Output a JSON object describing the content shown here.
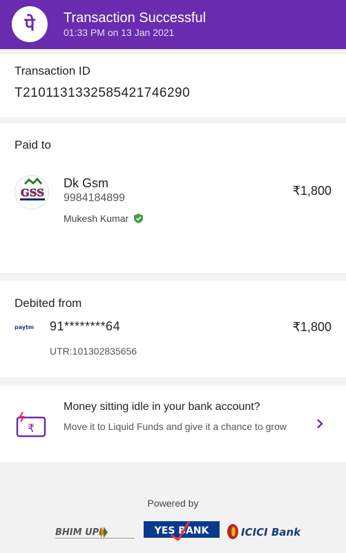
{
  "header": {
    "title": "Transaction Successful",
    "timestamp": "01:33 PM on 13 Jan 2021",
    "logo_icon": "phonepe-logo-icon",
    "bg_color": "#6a2cae"
  },
  "transaction": {
    "label": "Transaction ID",
    "id": "T2101131332585421746290"
  },
  "paid_to": {
    "label": "Paid to",
    "name": "Dk Gsm",
    "phone": "9984184899",
    "verified_name": "Mukesh Kumar",
    "amount": "₹1,800",
    "avatar_text": "GSS"
  },
  "debited_from": {
    "label": "Debited from",
    "account": "91********64",
    "utr": "UTR:101302835656",
    "amount": "₹1,800",
    "wallet_logo_text": "paytm"
  },
  "promo": {
    "title": "Money sitting idle in your bank account?",
    "subtitle": "Move it to Liquid Funds and give it a chance to grow"
  },
  "footer": {
    "powered_by": "Powered by",
    "partners": [
      "BHIM UPI",
      "YES BANK",
      "ICICI Bank"
    ]
  }
}
